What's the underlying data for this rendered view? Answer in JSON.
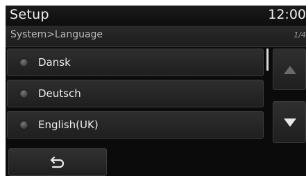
{
  "header": {
    "title": "Setup",
    "clock": "12:00"
  },
  "subheader": {
    "breadcrumb": "System>Language",
    "page_indicator": "1/4"
  },
  "language_list": {
    "items": [
      {
        "label": "Dansk",
        "selected": false
      },
      {
        "label": "Deutsch",
        "selected": false
      },
      {
        "label": "English(UK)",
        "selected": false
      }
    ]
  },
  "controls": {
    "scroll_up_icon": "triangle-up-icon",
    "scroll_down_icon": "triangle-down-icon",
    "back_icon": "back-arrow-icon"
  },
  "colors": {
    "background": "#0b0b0b",
    "text": "#ededed",
    "button": "#2a2a2a",
    "disabled_arrow": "#6a6a6a"
  }
}
